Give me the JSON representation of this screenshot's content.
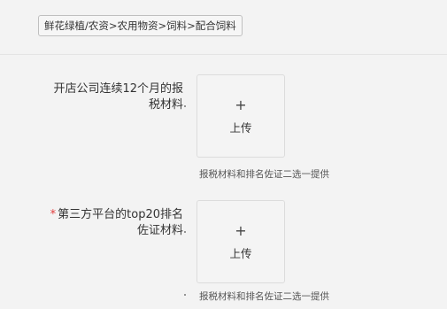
{
  "breadcrumb": {
    "text": "鲜花绿植/农资>农用物资>饲料>配合饲料"
  },
  "fields": [
    {
      "label_line1": "开店公司连续12个月的报",
      "label_line2": "税材料",
      "required": false,
      "upload": {
        "plus": "+",
        "label": "上传"
      },
      "hint": "报税材料和排名佐证二选一提供"
    },
    {
      "label_line1": "第三方平台的top20排名",
      "label_line2": "佐证材料",
      "required": true,
      "required_mark": "*",
      "upload": {
        "plus": "+",
        "label": "上传"
      },
      "hint": "报税材料和排名佐证二选一提供"
    }
  ]
}
